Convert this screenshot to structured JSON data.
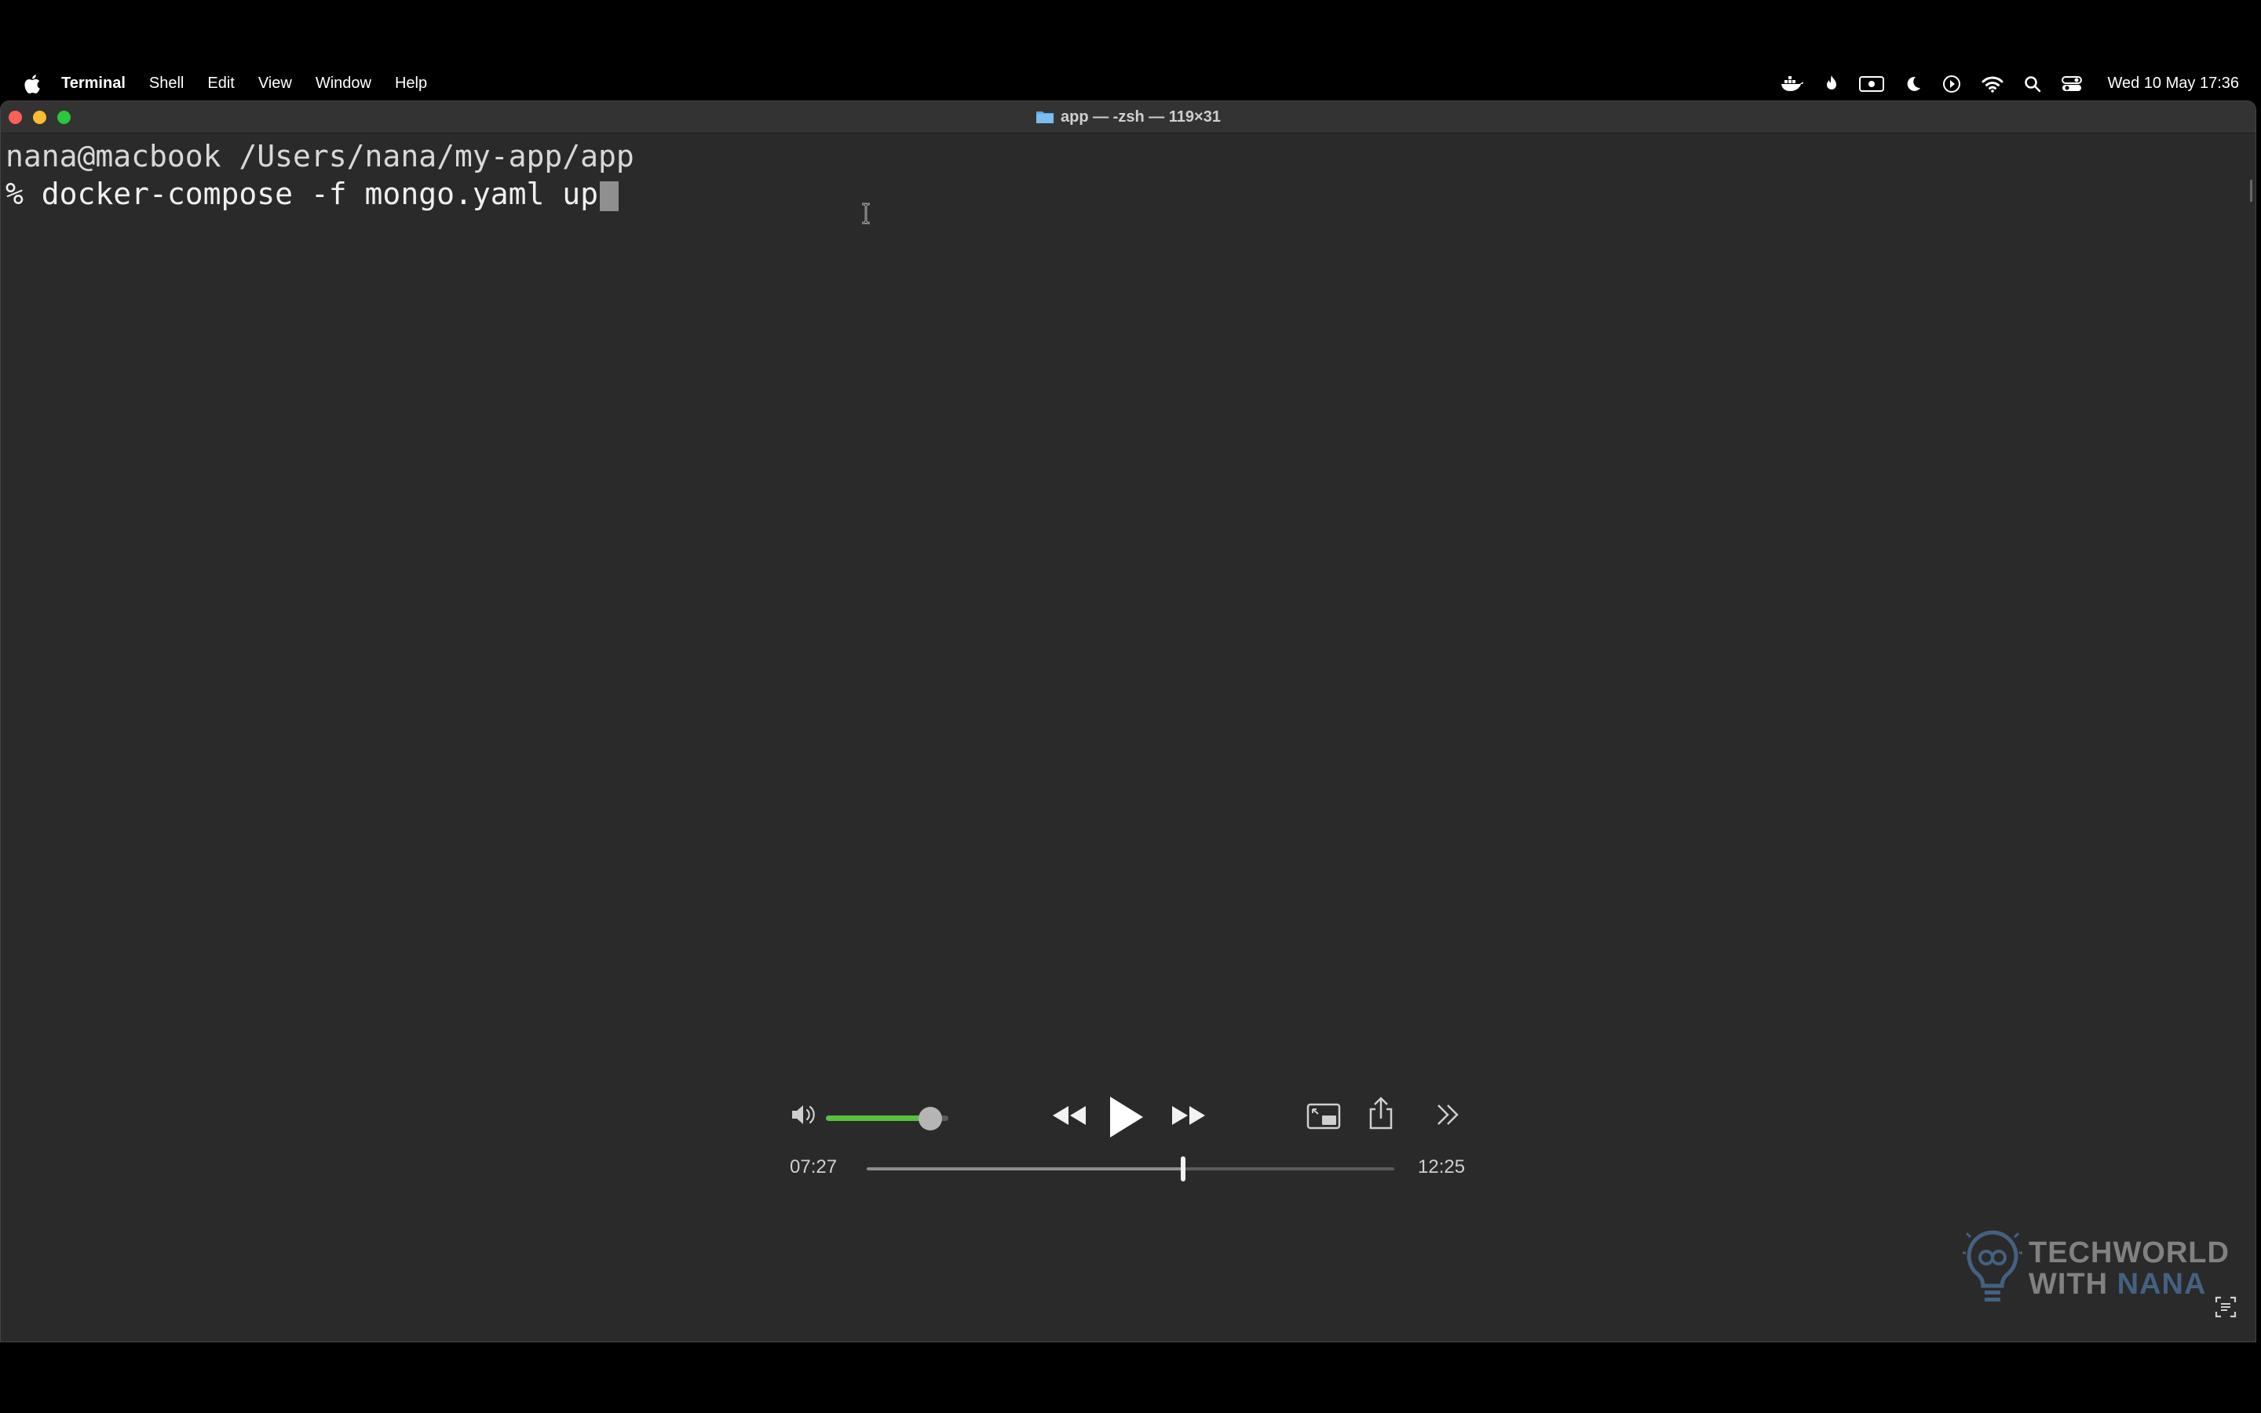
{
  "menubar": {
    "app_name": "Terminal",
    "items": [
      "Shell",
      "Edit",
      "View",
      "Window",
      "Help"
    ],
    "clock": "Wed 10 May  17:36"
  },
  "window": {
    "title": "app — -zsh — 119×31"
  },
  "terminal": {
    "prompt_line": "nana@macbook /Users/nana/my-app/app",
    "command_line": "% docker-compose -f mongo.yaml up"
  },
  "player": {
    "current_time": "07:27",
    "duration": "12:25",
    "progress_fraction": 0.6,
    "volume_fraction": 0.85
  },
  "watermark": {
    "line1": "TECHWORLD",
    "line2_prefix": "WITH ",
    "line2_highlight": "NANA"
  },
  "colors": {
    "terminal_bg": "#2a2a2a",
    "volume_accent": "#56c13a",
    "close": "#fe5f57",
    "minimize": "#febc2e",
    "zoom": "#28c840"
  }
}
